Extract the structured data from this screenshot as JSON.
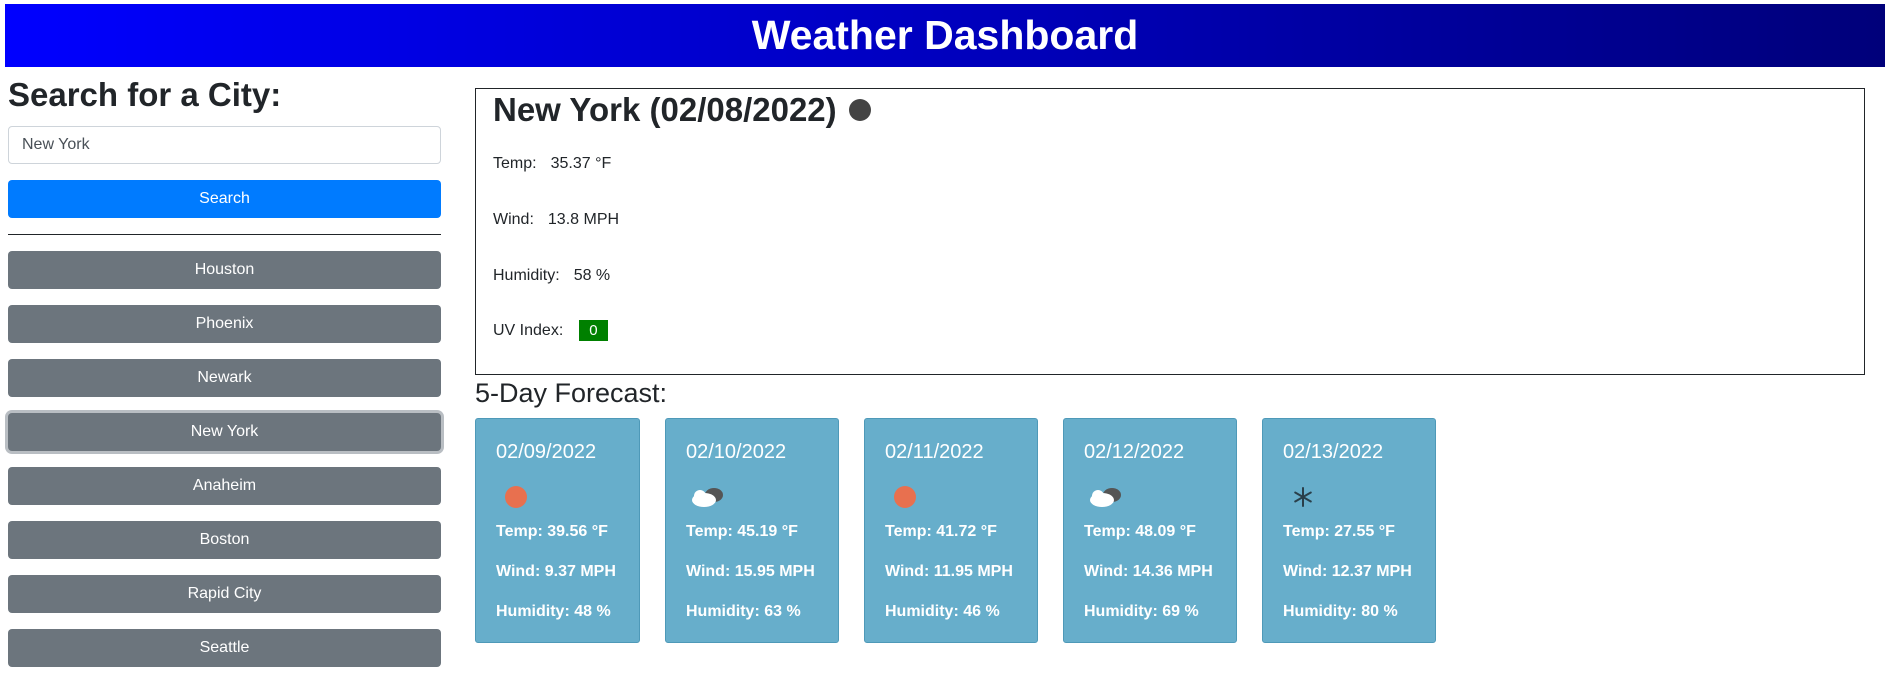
{
  "header": {
    "title": "Weather Dashboard"
  },
  "sidebar": {
    "title": "Search for a City:",
    "search_value": "New York",
    "search_button": "Search",
    "cities": [
      "Houston",
      "Phoenix",
      "Newark",
      "New York",
      "Anaheim",
      "Boston",
      "Rapid City",
      "Seattle"
    ],
    "active_city": "New York"
  },
  "current": {
    "title": "New York (02/08/2022)",
    "icon": "dark-circle-icon",
    "temp_label": "Temp:",
    "temp_value": "35.37 °F",
    "wind_label": "Wind:",
    "wind_value": "13.8 MPH",
    "humidity_label": "Humidity:",
    "humidity_value": "58 %",
    "uv_label": "UV Index:",
    "uv_value": "0",
    "uv_color": "#008000"
  },
  "forecast": {
    "title": "5-Day Forecast:",
    "days": [
      {
        "date": "02/09/2022",
        "icon": "sun-icon",
        "temp": "Temp: 39.56 °F",
        "wind": "Wind: 9.37 MPH",
        "humidity": "Humidity: 48 %"
      },
      {
        "date": "02/10/2022",
        "icon": "cloud-icon",
        "temp": "Temp: 45.19 °F",
        "wind": "Wind: 15.95 MPH",
        "humidity": "Humidity: 63 %"
      },
      {
        "date": "02/11/2022",
        "icon": "sun-icon",
        "temp": "Temp: 41.72 °F",
        "wind": "Wind: 11.95 MPH",
        "humidity": "Humidity: 46 %"
      },
      {
        "date": "02/12/2022",
        "icon": "cloud-icon",
        "temp": "Temp: 48.09 °F",
        "wind": "Wind: 14.36 MPH",
        "humidity": "Humidity: 69 %"
      },
      {
        "date": "02/13/2022",
        "icon": "snowflake-icon",
        "temp": "Temp: 27.55 °F",
        "wind": "Wind: 12.37 MPH",
        "humidity": "Humidity: 80 %"
      }
    ]
  },
  "colors": {
    "header_gradient_start": "#0000ff",
    "header_gradient_end": "#00007a",
    "search_button": "#007bff",
    "city_button": "#6c757d",
    "forecast_card": "#67aecb",
    "sun_icon": "#e8704f"
  }
}
